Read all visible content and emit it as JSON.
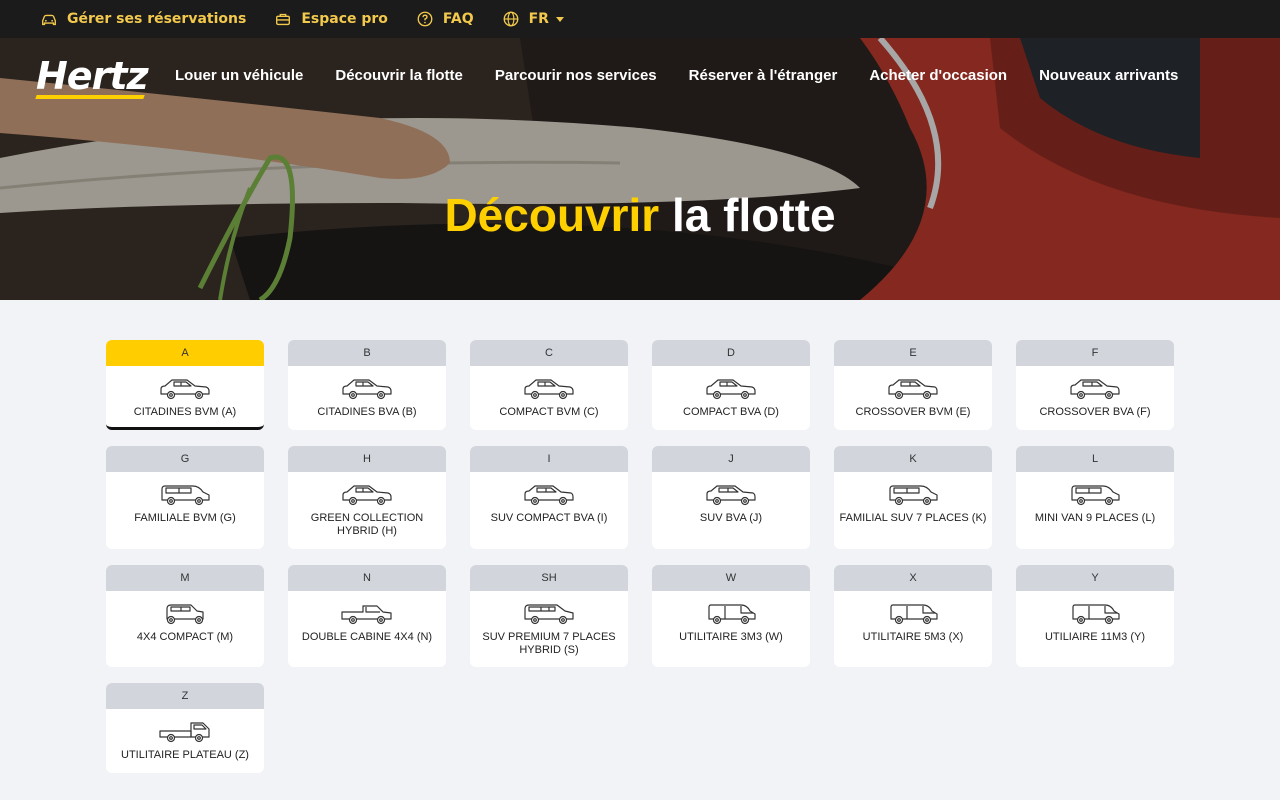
{
  "topbar": {
    "items": [
      {
        "label": "Gérer ses réservations",
        "icon": "car-icon"
      },
      {
        "label": "Espace pro",
        "icon": "briefcase-icon"
      },
      {
        "label": "FAQ",
        "icon": "help-circle-icon"
      },
      {
        "label": "FR",
        "icon": "globe-icon"
      }
    ]
  },
  "brand": {
    "name": "Hertz",
    "accent_color": "#ffd000"
  },
  "nav": {
    "links": [
      "Louer un véhicule",
      "Découvrir la flotte",
      "Parcourir nos services",
      "Réserver à l'étranger",
      "Acheter d'occasion",
      "Nouveaux arrivants"
    ]
  },
  "hero": {
    "title_accent": "Découvrir",
    "title_rest": "la flotte"
  },
  "fleet": [
    {
      "code": "A",
      "label": "CITADINES BVM (A)",
      "active": true,
      "icon": "small-car-icon"
    },
    {
      "code": "B",
      "label": "CITADINES BVA (B)",
      "icon": "small-car-icon"
    },
    {
      "code": "C",
      "label": "COMPACT BVM (C)",
      "icon": "hatchback-icon"
    },
    {
      "code": "D",
      "label": "COMPACT BVA (D)",
      "icon": "hatchback-icon"
    },
    {
      "code": "E",
      "label": "CROSSOVER BVM (E)",
      "icon": "crossover-icon"
    },
    {
      "code": "F",
      "label": "CROSSOVER BVA (F)",
      "icon": "crossover-icon"
    },
    {
      "code": "G",
      "label": "FAMILIALE BVM (G)",
      "icon": "family-van-icon"
    },
    {
      "code": "H",
      "label": "GREEN COLLECTION HYBRID (H)",
      "icon": "hybrid-car-icon"
    },
    {
      "code": "I",
      "label": "SUV COMPACT BVA (I)",
      "icon": "suv-icon"
    },
    {
      "code": "J",
      "label": "SUV BVA (J)",
      "icon": "suv-icon"
    },
    {
      "code": "K",
      "label": "FAMILIAL SUV 7 PLACES (K)",
      "icon": "minivan-icon"
    },
    {
      "code": "L",
      "label": "MINI VAN 9 PLACES (L)",
      "icon": "minivan-icon"
    },
    {
      "code": "M",
      "label": "4X4 COMPACT (M)",
      "icon": "4x4-icon"
    },
    {
      "code": "N",
      "label": "DOUBLE CABINE 4X4 (N)",
      "icon": "pickup-icon"
    },
    {
      "code": "SH",
      "label": "SUV PREMIUM 7 PLACES HYBRID (S)",
      "icon": "premium-suv-icon"
    },
    {
      "code": "W",
      "label": "UTILITAIRE 3M3 (W)",
      "icon": "small-van-icon"
    },
    {
      "code": "X",
      "label": "UTILITAIRE 5M3 (X)",
      "icon": "van-icon"
    },
    {
      "code": "Y",
      "label": "UTILIAIRE 11M3 (Y)",
      "icon": "large-van-icon"
    },
    {
      "code": "Z",
      "label": "UTILITAIRE PLATEAU (Z)",
      "icon": "flatbed-truck-icon"
    }
  ]
}
